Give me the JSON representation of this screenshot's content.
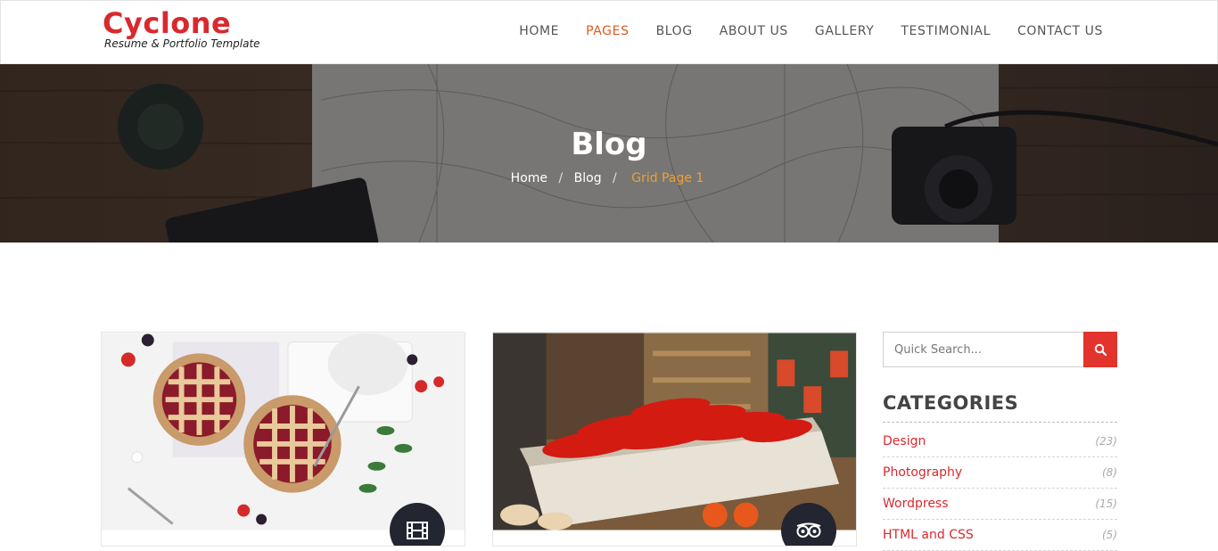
{
  "brand": {
    "title": "Cyclone",
    "subtitle": "Resume & Portfolio Template"
  },
  "nav": {
    "items": [
      "HOME",
      "PAGES",
      "BLOG",
      "ABOUT US",
      "GALLERY",
      "TESTIMONIAL",
      "CONTACT US"
    ],
    "active": "PAGES"
  },
  "hero": {
    "title": "Blog",
    "breadcrumb": [
      "Home",
      "Blog",
      "Grid Page 1"
    ]
  },
  "cards": [
    {
      "badge_icon": "film-icon"
    },
    {
      "badge_icon": "tripadvisor-icon"
    }
  ],
  "sidebar": {
    "search_placeholder": "Quick Search...",
    "search_icon": "search-icon",
    "categories_title": "CATEGORIES",
    "categories": [
      {
        "label": "Design",
        "count": "(23)"
      },
      {
        "label": "Photography",
        "count": "(8)"
      },
      {
        "label": "Wordpress",
        "count": "(15)"
      },
      {
        "label": "HTML and CSS",
        "count": "(5)"
      }
    ]
  },
  "colors": {
    "accent": "#d8292f",
    "nav_active": "#e05a1c",
    "breadcrumb_current": "#f0a030",
    "search_button": "#e2342c",
    "badge": "#232530"
  }
}
